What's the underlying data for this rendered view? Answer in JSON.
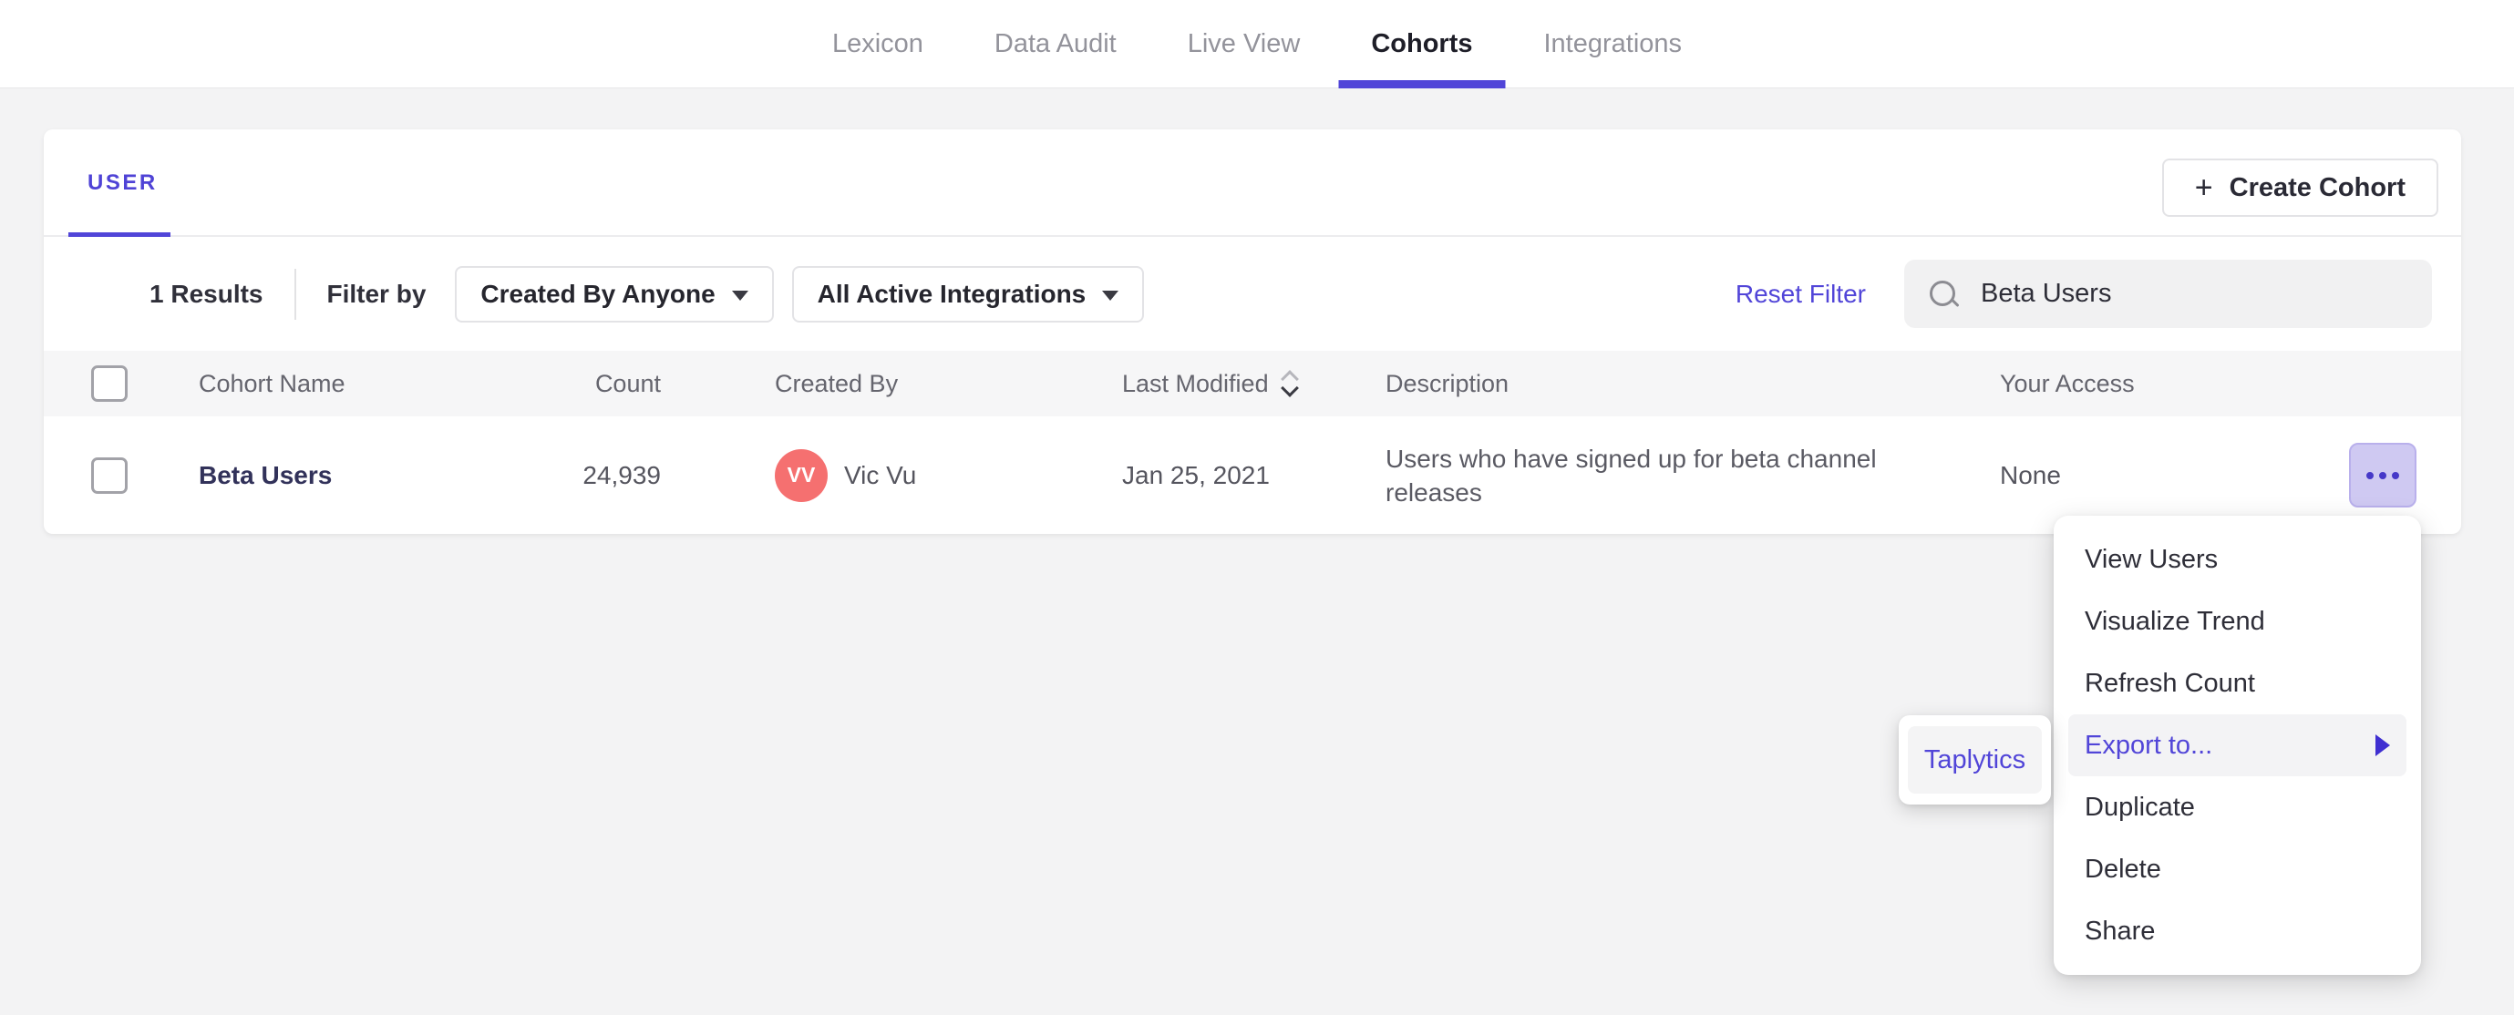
{
  "colors": {
    "accent": "#5145d8",
    "avatar_bg": "#f57070",
    "page_bg": "#f3f3f4",
    "more_button_bg": "#cfc9f2"
  },
  "nav": {
    "tabs": [
      {
        "label": "Lexicon",
        "active": false
      },
      {
        "label": "Data Audit",
        "active": false
      },
      {
        "label": "Live View",
        "active": false
      },
      {
        "label": "Cohorts",
        "active": true
      },
      {
        "label": "Integrations",
        "active": false
      }
    ]
  },
  "cohort_panel": {
    "tab_label": "USER",
    "create_button_label": "Create Cohort",
    "plus_icon": "+",
    "filters": {
      "results_count": "1 Results",
      "filter_by_label": "Filter by",
      "created_by_dropdown": "Created By Anyone",
      "integrations_dropdown": "All Active Integrations",
      "reset_link": "Reset Filter",
      "search_value": "Beta Users"
    },
    "table": {
      "headers": {
        "name": "Cohort Name",
        "count": "Count",
        "created_by": "Created By",
        "last_modified": "Last Modified",
        "description": "Description",
        "access": "Your Access"
      },
      "rows": [
        {
          "name": "Beta Users",
          "count": "24,939",
          "avatar_initials": "VV",
          "created_by": "Vic Vu",
          "last_modified": "Jan 25, 2021",
          "description": "Users who have signed up for beta channel releases",
          "access": "None"
        }
      ]
    }
  },
  "context_menu": {
    "items": {
      "view_users": "View Users",
      "visualize_trend": "Visualize Trend",
      "refresh_count": "Refresh Count",
      "export_to": "Export to...",
      "duplicate": "Duplicate",
      "delete": "Delete",
      "share": "Share"
    },
    "highlighted_item": "Export to...",
    "submenu": {
      "taplytics": "Taplytics"
    }
  }
}
